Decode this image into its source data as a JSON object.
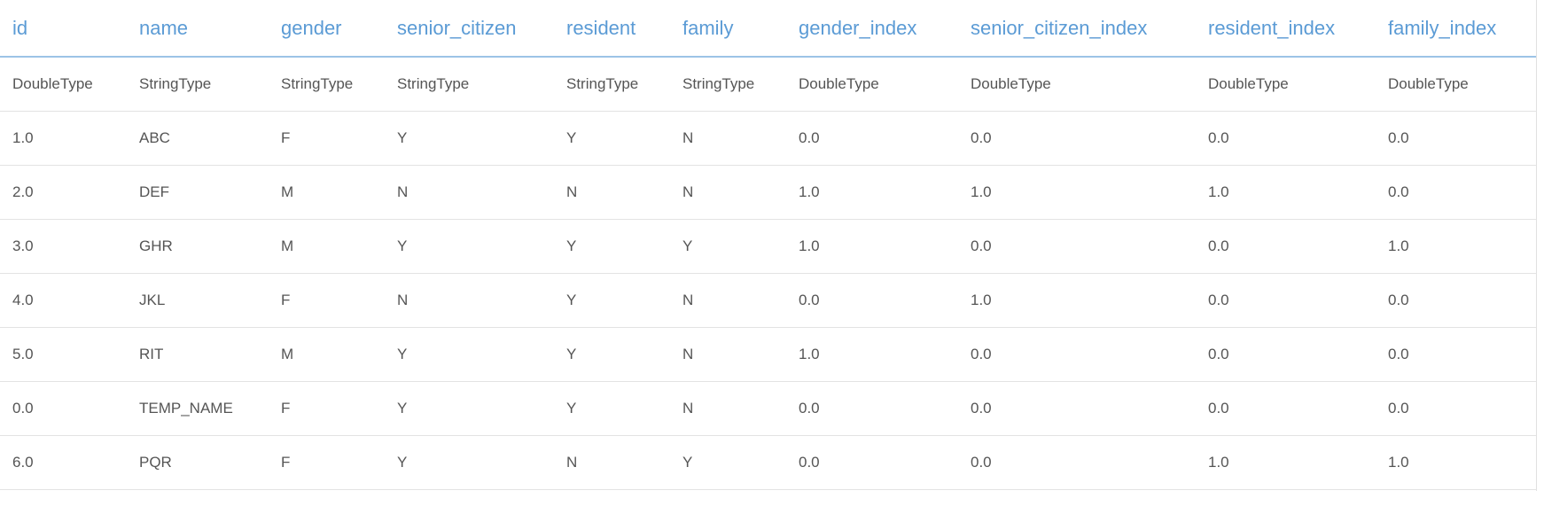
{
  "table": {
    "columns": [
      "id",
      "name",
      "gender",
      "senior_citizen",
      "resident",
      "family",
      "gender_index",
      "senior_citizen_index",
      "resident_index",
      "family_index"
    ],
    "types": [
      "DoubleType",
      "StringType",
      "StringType",
      "StringType",
      "StringType",
      "StringType",
      "DoubleType",
      "DoubleType",
      "DoubleType",
      "DoubleType"
    ],
    "rows": [
      [
        "1.0",
        "ABC",
        "F",
        "Y",
        "Y",
        "N",
        "0.0",
        "0.0",
        "0.0",
        "0.0"
      ],
      [
        "2.0",
        "DEF",
        "M",
        "N",
        "N",
        "N",
        "1.0",
        "1.0",
        "1.0",
        "0.0"
      ],
      [
        "3.0",
        "GHR",
        "M",
        "Y",
        "Y",
        "Y",
        "1.0",
        "0.0",
        "0.0",
        "1.0"
      ],
      [
        "4.0",
        "JKL",
        "F",
        "N",
        "Y",
        "N",
        "0.0",
        "1.0",
        "0.0",
        "0.0"
      ],
      [
        "5.0",
        "RIT",
        "M",
        "Y",
        "Y",
        "N",
        "1.0",
        "0.0",
        "0.0",
        "0.0"
      ],
      [
        "0.0",
        "TEMP_NAME",
        "F",
        "Y",
        "Y",
        "N",
        "0.0",
        "0.0",
        "0.0",
        "0.0"
      ],
      [
        "6.0",
        "PQR",
        "F",
        "Y",
        "N",
        "Y",
        "0.0",
        "0.0",
        "1.0",
        "1.0"
      ]
    ]
  },
  "colors": {
    "header_text": "#5b9bd5",
    "header_border": "#9cc3e6",
    "cell_text": "#555555",
    "row_border": "#e3e3e3"
  }
}
